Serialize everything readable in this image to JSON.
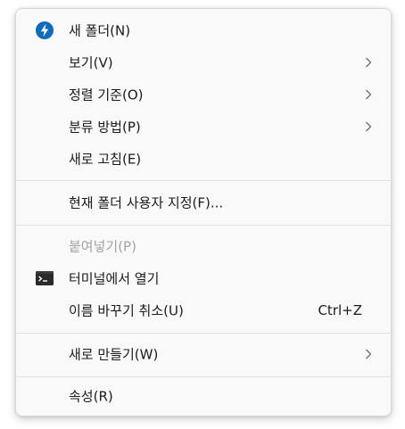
{
  "menu": {
    "items": [
      {
        "label": "새 폴더(N)",
        "icon": "new-folder-lightning-icon"
      },
      {
        "label": "보기(V)",
        "submenu": true
      },
      {
        "label": "정렬 기준(O)",
        "submenu": true
      },
      {
        "label": "분류 방법(P)",
        "submenu": true
      },
      {
        "label": "새로 고침(E)"
      },
      {
        "label": "현재 폴더 사용자 지정(F)..."
      },
      {
        "label": "붙여넣기(P)",
        "disabled": true
      },
      {
        "label": "터미널에서 열기",
        "icon": "terminal-icon"
      },
      {
        "label": "이름 바꾸기 취소(U)",
        "shortcut": "Ctrl+Z"
      },
      {
        "label": "새로 만들기(W)",
        "submenu": true
      },
      {
        "label": "속성(R)"
      }
    ]
  },
  "colors": {
    "menu_background": "#f9f9f9",
    "text": "#1b1b1b",
    "disabled_text": "#a3a3a3",
    "accent_blue": "#0f6cbd",
    "separator": "#e0e0e0"
  }
}
